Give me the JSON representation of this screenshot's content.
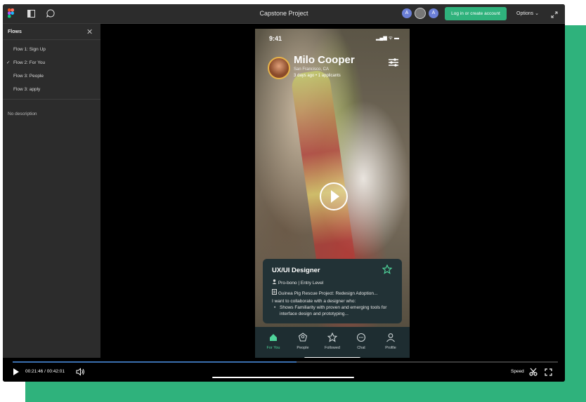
{
  "window": {
    "title": "Capstone Project",
    "collaborators": [
      "A",
      "A"
    ],
    "login_button": "Log in or create account",
    "options_label": "Options",
    "options_chevron": "⌄"
  },
  "sidebar": {
    "header": "Flows",
    "close_glyph": "✕",
    "flows": [
      {
        "label": "Flow 1: Sign Up",
        "selected": false
      },
      {
        "label": "Flow 2: For You",
        "selected": true
      },
      {
        "label": "Flow 3: People",
        "selected": false
      },
      {
        "label": "Flow 3: apply",
        "selected": false
      }
    ],
    "check_glyph": "✓",
    "description": "No description"
  },
  "phone": {
    "time": "9:41",
    "status_icons": "▂▄▆ ᯤ ▬",
    "profile": {
      "name": "Milo Cooper",
      "location": "San Francisco, CA",
      "stats": "3 days ago • 1 applicants"
    },
    "job": {
      "title": "UX/UI Designer",
      "type": "Pro-bono | Entry Level",
      "project": "Guinea Pig Rescue Project: Redesign Adoption...",
      "description": "I want to collaborate with a designer who:",
      "bullet": "Shows Familiarity with proven and emerging tools for interface design and prototyping..."
    },
    "tabs": [
      {
        "label": "For You",
        "icon": "home-icon",
        "active": true
      },
      {
        "label": "People",
        "icon": "people-icon",
        "active": false
      },
      {
        "label": "Followed",
        "icon": "star-icon",
        "active": false
      },
      {
        "label": "Chat",
        "icon": "chat-icon",
        "active": false
      },
      {
        "label": "Profile",
        "icon": "profile-icon",
        "active": false
      }
    ]
  },
  "player": {
    "time": "00:21:46 / 00:42:01",
    "progress": 0.52,
    "speed_label": "Speed"
  },
  "colors": {
    "accent_green": "#2fb27c",
    "active_tab": "#4fd49a",
    "card_bg": "#223236"
  }
}
